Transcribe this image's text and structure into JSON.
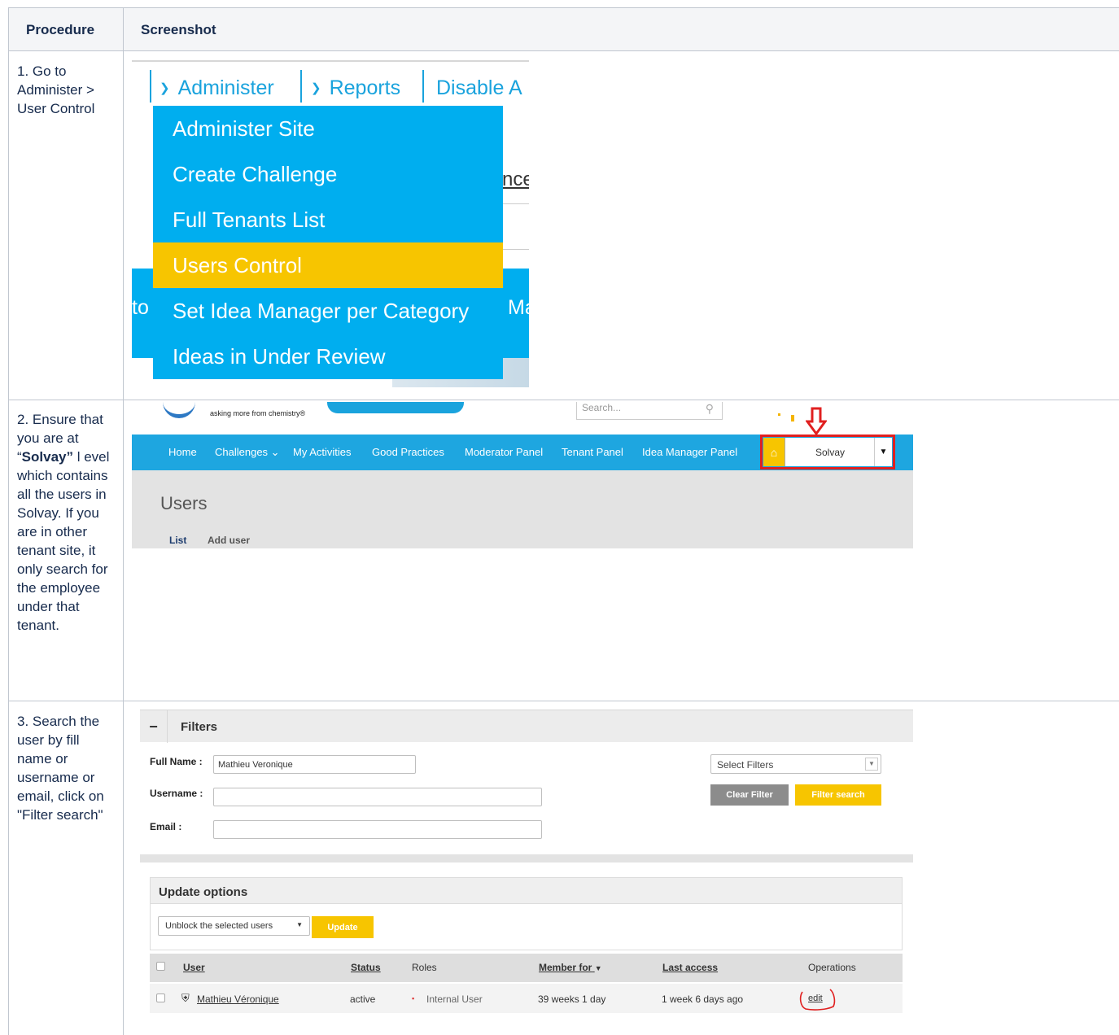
{
  "table": {
    "headers": {
      "procedure": "Procedure",
      "screenshot": "Screenshot"
    },
    "rows": [
      {
        "procedure": "1. Go to Administer > User Control"
      },
      {
        "procedure_pre": "2. Ensure that you are at “",
        "procedure_bold": "Solvay”",
        "procedure_post": " l evel which contains all the users in Solvay. If you are in other tenant site, it only search for the employee under that tenant."
      },
      {
        "procedure": "3. Search the user by fill name or username or email, click on \"Filter search\""
      }
    ]
  },
  "step1": {
    "nav": {
      "administer": "Administer",
      "reports": "Reports",
      "disable": "Disable A"
    },
    "partial_text": "nce",
    "side_left": "to",
    "side_right": "Ma",
    "menu": [
      {
        "label": "Administer Site",
        "selected": false
      },
      {
        "label": "Create Challenge",
        "selected": false
      },
      {
        "label": "Full Tenants List",
        "selected": false
      },
      {
        "label": "Users Control",
        "selected": true
      },
      {
        "label": "Set Idea Manager per Category",
        "selected": false
      },
      {
        "label": "Ideas in Under Review",
        "selected": false
      }
    ],
    "colors": {
      "menu_bg": "#00aeef",
      "selected_bg": "#f7c500"
    }
  },
  "step2": {
    "tagline": "asking more from chemistry®",
    "search_placeholder": "Search...",
    "nav": [
      "Home",
      "Challenges ⌄",
      "My Activities",
      "Good Practices",
      "Moderator Panel",
      "Tenant Panel",
      "Idea Manager Panel"
    ],
    "tenant_value": "Solvay",
    "page_title": "Users",
    "tabs": [
      "List",
      "Add user"
    ],
    "colors": {
      "nav_bg": "#1ea6e0",
      "highlight": "#e02020"
    }
  },
  "step3": {
    "filters_title": "Filters",
    "full_name_label": "Full Name :",
    "full_name_value": "Mathieu Veronique",
    "username_label": "Username :",
    "email_label": "Email :",
    "select_filters": "Select Filters",
    "clear_filter": "Clear Filter",
    "filter_search": "Filter search",
    "update_options_title": "Update options",
    "bulk_action": "Unblock the selected users",
    "update_button": "Update",
    "columns": [
      "User",
      "Status",
      "Roles",
      "Member for",
      "Last access",
      "Operations"
    ],
    "row": {
      "user": "Mathieu Véronique",
      "status": "active",
      "roles": "Internal User",
      "member_for": "39 weeks 1 day",
      "last_access": "1 week 6 days ago",
      "operation": "edit"
    }
  }
}
